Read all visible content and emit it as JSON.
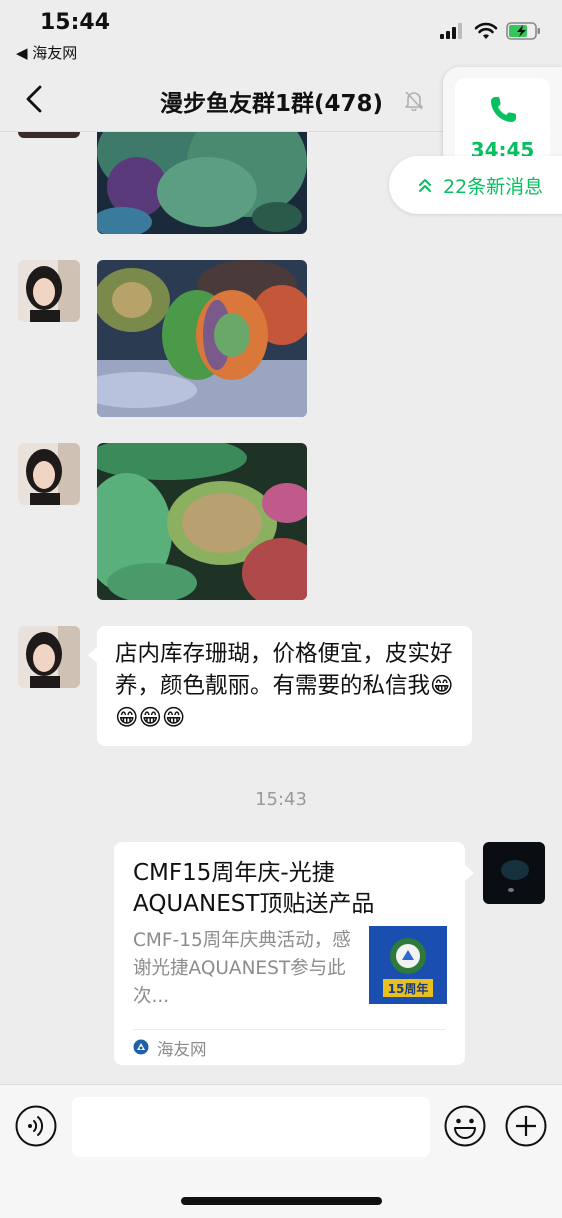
{
  "status_bar": {
    "time": "15:44",
    "back_app": "◀ 海友网",
    "icons": [
      "cellular-signal-icon",
      "wifi-icon",
      "battery-charging-icon"
    ]
  },
  "nav": {
    "title": "漫步鱼友群1群(478)",
    "icons": [
      "back-chevron-icon",
      "mute-bell-icon"
    ]
  },
  "call_widget": {
    "duration": "34:45",
    "icon": "phone-icon",
    "accent_color": "#07c160"
  },
  "new_messages": {
    "label": "22条新消息",
    "icon": "double-chevron-up-icon"
  },
  "messages": [
    {
      "type": "image",
      "sender": "other",
      "subject": "green coral with purple corals"
    },
    {
      "type": "image",
      "sender": "other",
      "subject": "orange and green brain coral"
    },
    {
      "type": "image",
      "sender": "other",
      "subject": "green coral close-up"
    },
    {
      "type": "text",
      "sender": "other",
      "text": "店内库存珊瑚，价格便宜，皮实好养，颜色靓丽。有需要的私信我😁😁😁😁"
    }
  ],
  "timestamp": "15:43",
  "link_card": {
    "title": "CMF15周年庆-光捷AQUANEST顶贴送产品",
    "description": "CMF-15周年庆典活动，感谢光捷AQUANEST参与此次...",
    "thumb_text": "15周年",
    "source": "海友网",
    "source_icon": "haiyou-logo-icon"
  },
  "input_bar": {
    "placeholder": "",
    "icons": [
      "voice-icon",
      "emoji-icon",
      "plus-icon"
    ]
  },
  "colors": {
    "background": "#ededed",
    "accent": "#07c160",
    "bubble": "#ffffff"
  }
}
